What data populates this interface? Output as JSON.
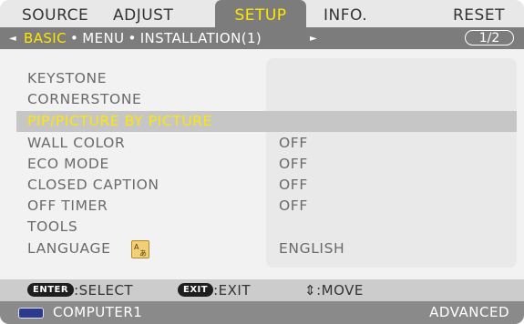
{
  "tabs": [
    {
      "label": "SOURCE"
    },
    {
      "label": "ADJUST"
    },
    {
      "label": "SETUP"
    },
    {
      "label": "INFO."
    },
    {
      "label": "RESET"
    }
  ],
  "subtabs": {
    "left_arrow": "◄",
    "right_arrow": "►",
    "items": [
      {
        "label": "BASIC"
      },
      {
        "label": "MENU"
      },
      {
        "label": "INSTALLATION(1)"
      }
    ],
    "dot": "•",
    "page": "1/2"
  },
  "menu": [
    {
      "label": "KEYSTONE",
      "value": ""
    },
    {
      "label": "CORNERSTONE",
      "value": ""
    },
    {
      "label": "PIP/PICTURE BY PICTURE",
      "value": ""
    },
    {
      "label": "WALL COLOR",
      "value": "OFF"
    },
    {
      "label": "ECO MODE",
      "value": "OFF"
    },
    {
      "label": "CLOSED CAPTION",
      "value": "OFF"
    },
    {
      "label": "OFF TIMER",
      "value": "OFF"
    },
    {
      "label": "TOOLS",
      "value": ""
    },
    {
      "label": "LANGUAGE",
      "value": "ENGLISH"
    }
  ],
  "help": {
    "enter_key": "ENTER",
    "enter_text": ":SELECT",
    "exit_key": "EXIT",
    "exit_text": ":EXIT",
    "move_text": "⇕:MOVE"
  },
  "status": {
    "source": "COMPUTER1",
    "mode": "ADVANCED"
  },
  "colors": {
    "active": "#ffe600",
    "tab_active_bg": "#7c7c7c",
    "highlight_row": "#c6c6c6"
  },
  "icons": {
    "language": "language-icon",
    "computer": "computer-input-icon"
  }
}
